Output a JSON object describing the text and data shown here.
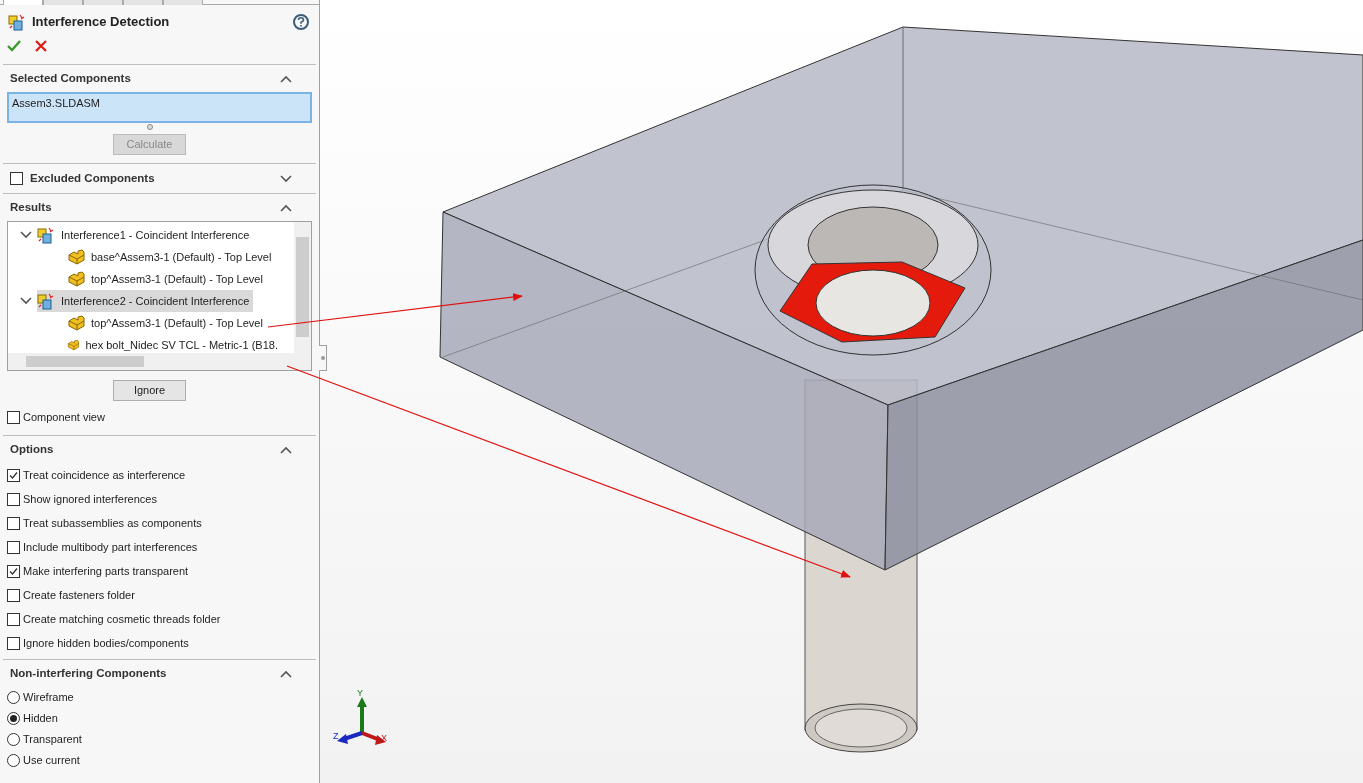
{
  "tabs": [
    {
      "selected": true
    },
    {
      "selected": false
    },
    {
      "selected": false
    },
    {
      "selected": false
    },
    {
      "selected": false
    }
  ],
  "panel": {
    "title": "Interference Detection"
  },
  "selected_components": {
    "heading": "Selected Components",
    "expanded": true,
    "value": "Assem3.SLDASM",
    "button": {
      "label": "Calculate",
      "disabled": true
    }
  },
  "excluded_components": {
    "heading": "Excluded Components",
    "checked": false,
    "expanded": false
  },
  "results": {
    "heading": "Results",
    "expanded": true,
    "items": [
      {
        "label": "Interference1 - Coincident Interference",
        "expanded": true,
        "selected": false,
        "children": [
          {
            "label": "base^Assem3-1 (Default) - Top Level"
          },
          {
            "label": "top^Assem3-1 (Default) - Top Level"
          }
        ]
      },
      {
        "label": "Interference2 - Coincident Interference",
        "expanded": true,
        "selected": true,
        "children": [
          {
            "label": "top^Assem3-1 (Default) - Top Level"
          },
          {
            "label": "hex bolt_Nidec SV TCL - Metric-1 (B18."
          }
        ]
      }
    ],
    "button": {
      "label": "Ignore",
      "disabled": false
    },
    "component_view": {
      "label": "Component view",
      "checked": false
    }
  },
  "options": {
    "heading": "Options",
    "expanded": true,
    "items": [
      {
        "label": "Treat coincidence as interference",
        "checked": true
      },
      {
        "label": "Show ignored interferences",
        "checked": false
      },
      {
        "label": "Treat subassemblies as components",
        "checked": false
      },
      {
        "label": "Include multibody part interferences",
        "checked": false
      },
      {
        "label": "Make interfering parts transparent",
        "checked": true
      },
      {
        "label": "Create fasteners folder",
        "checked": false
      },
      {
        "label": "Create matching cosmetic threads folder",
        "checked": false
      },
      {
        "label": "Ignore hidden bodies/components",
        "checked": false
      }
    ]
  },
  "non_interfering": {
    "heading": "Non-interfering Components",
    "expanded": true,
    "items": [
      {
        "label": "Wireframe",
        "selected": false
      },
      {
        "label": "Hidden",
        "selected": true
      },
      {
        "label": "Transparent",
        "selected": false
      },
      {
        "label": "Use current",
        "selected": false
      }
    ]
  },
  "triad": {
    "x": "X",
    "y": "Y",
    "z": "Z"
  }
}
